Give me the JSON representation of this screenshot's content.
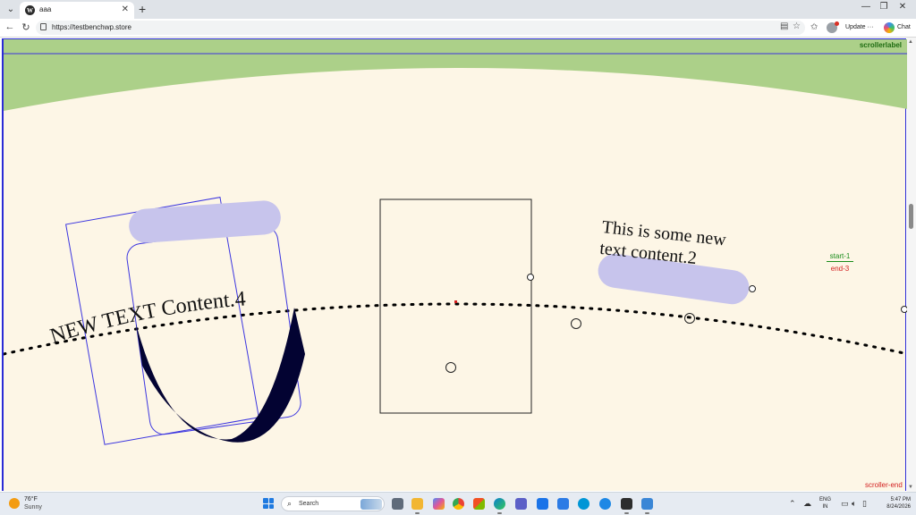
{
  "browser": {
    "tab_title": "aaa",
    "tab_close": "✕",
    "new_tab": "+",
    "url": "https://testbenchwp.store",
    "update_label": "Update",
    "chat_label": "Chat",
    "win_minimize": "—",
    "win_restore": "❐",
    "win_close": "✕",
    "back": "←",
    "reload": "↻",
    "tab_menu": "⌄",
    "more": "···"
  },
  "page": {
    "scroller_label": "scrollerlabel",
    "text_path": "NEW TEXT Content.4",
    "text_block_line1": "This is some new",
    "text_block_line2": "text content.2",
    "marker_start": "start-1",
    "marker_end": "end-3",
    "scroller_end": "scroller-end",
    "colors": {
      "header_green": "#acd089",
      "background_cream": "#fdf6e6",
      "pill_lavender": "#c7c4ec",
      "outline_blue": "#3b35e0",
      "dark_navy": "#030332",
      "red": "#d21f1f",
      "green": "#1a8c1a"
    }
  },
  "taskbar": {
    "weather_temp": "76°F",
    "weather_desc": "Sunny",
    "search_placeholder": "Search",
    "lang_line1": "ENG",
    "lang_line2": "IN",
    "time": "5:47 PM",
    "date": "8/24/2026"
  }
}
